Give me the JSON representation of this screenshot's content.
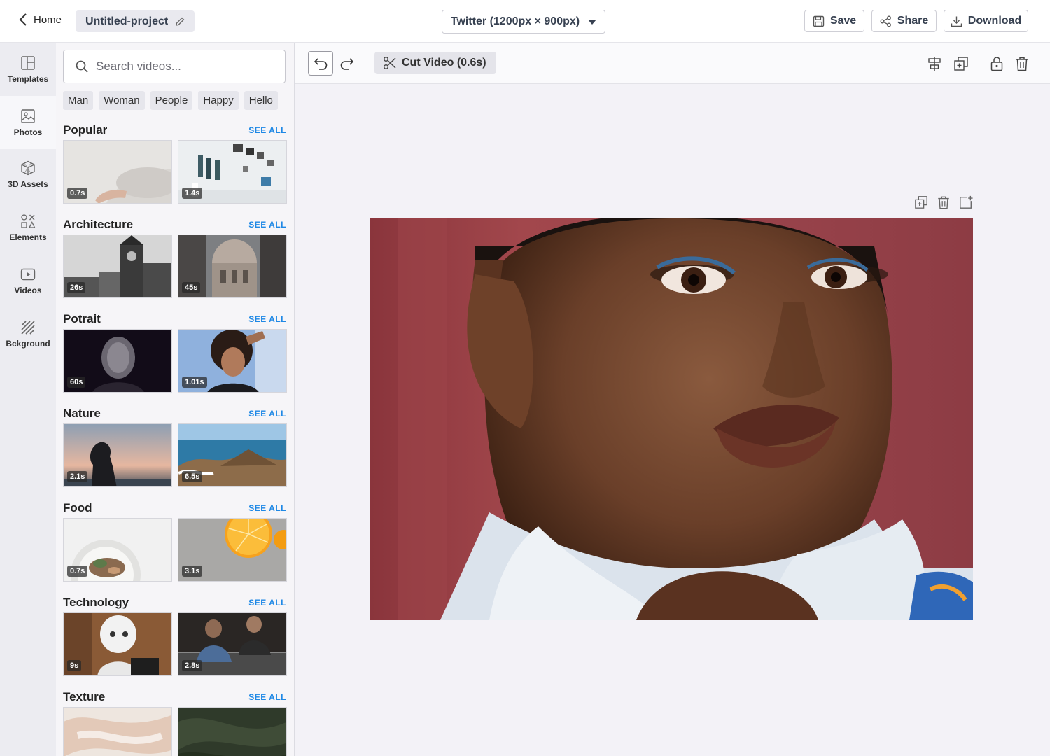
{
  "header": {
    "home_label": "Home",
    "project_name": "Untitled-project",
    "canvas_size": "Twitter (1200px × 900px)",
    "save_label": "Save",
    "share_label": "Share",
    "download_label": "Download"
  },
  "rail": {
    "items": [
      {
        "label": "Templates",
        "icon": "templates-icon"
      },
      {
        "label": "Photos",
        "icon": "photo-icon"
      },
      {
        "label": "3D Assets",
        "icon": "cube-icon"
      },
      {
        "label": "Elements",
        "icon": "shapes-icon"
      },
      {
        "label": "Videos",
        "icon": "video-icon"
      },
      {
        "label": "Bckground",
        "icon": "background-icon"
      }
    ]
  },
  "library": {
    "search_placeholder": "Search videos...",
    "tags": [
      "Man",
      "Woman",
      "People",
      "Happy",
      "Hello"
    ],
    "see_all_label": "SEE ALL",
    "sections": [
      {
        "title": "Popular",
        "items": [
          {
            "duration": "0.7s"
          },
          {
            "duration": "1.4s"
          }
        ]
      },
      {
        "title": "Architecture",
        "items": [
          {
            "duration": "26s"
          },
          {
            "duration": "45s"
          }
        ]
      },
      {
        "title": "Potrait",
        "items": [
          {
            "duration": "60s"
          },
          {
            "duration": "1.01s"
          }
        ]
      },
      {
        "title": "Nature",
        "items": [
          {
            "duration": "2.1s"
          },
          {
            "duration": "6.5s"
          }
        ]
      },
      {
        "title": "Food",
        "items": [
          {
            "duration": "0.7s"
          },
          {
            "duration": "3.1s"
          }
        ]
      },
      {
        "title": "Technology",
        "items": [
          {
            "duration": "9s"
          },
          {
            "duration": "2.8s"
          }
        ]
      },
      {
        "title": "Texture",
        "items": [
          {
            "duration": ""
          },
          {
            "duration": ""
          }
        ]
      }
    ]
  },
  "toolbar": {
    "cut_label": "Cut Video (0.6s)"
  },
  "colors": {
    "accent_link": "#1e88e5",
    "photo_background": "#9c3f45"
  }
}
